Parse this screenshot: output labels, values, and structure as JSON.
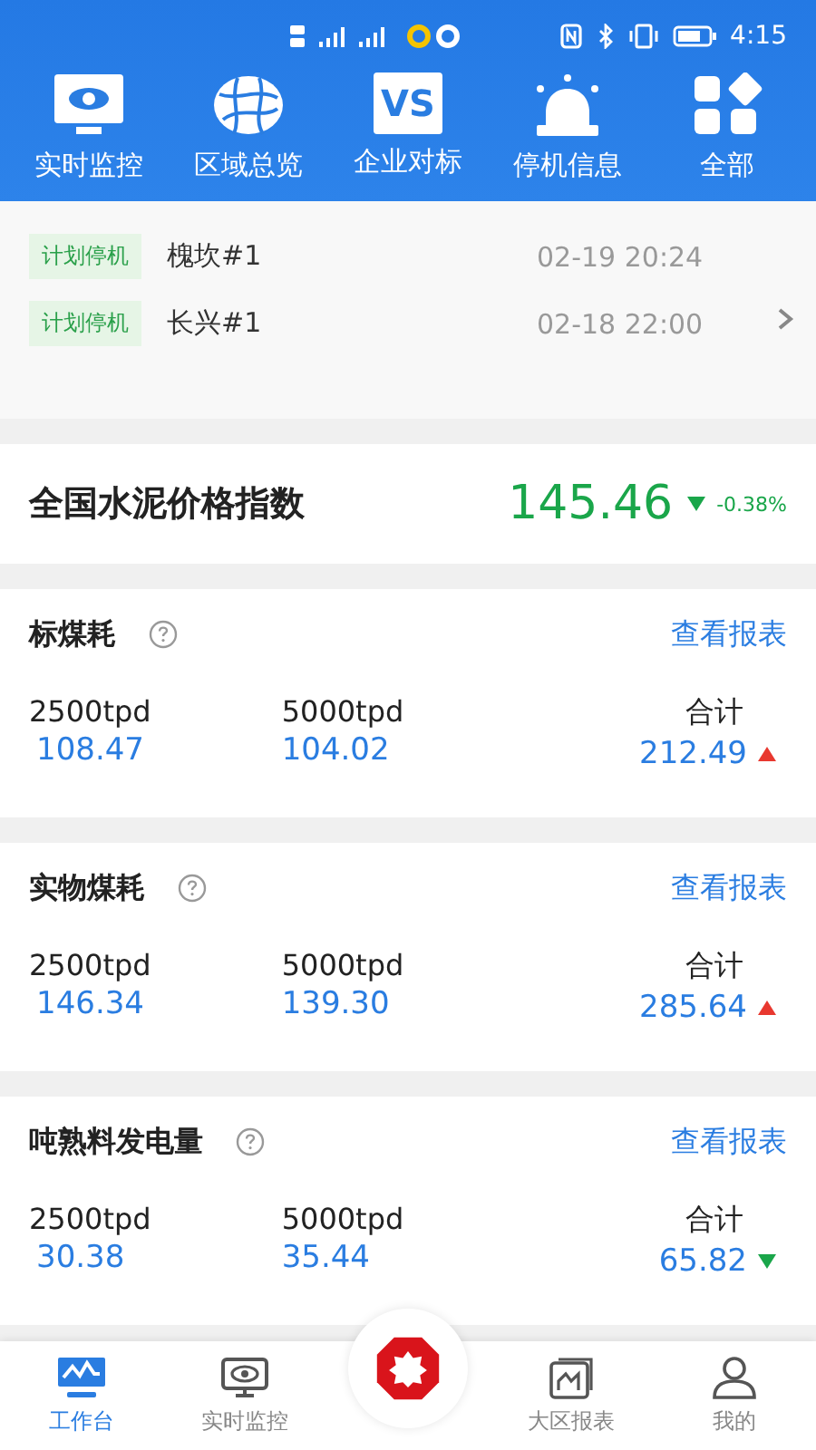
{
  "status_bar": {
    "time": "4:15"
  },
  "quick_nav": [
    {
      "label": "实时监控"
    },
    {
      "label": "区域总览"
    },
    {
      "label": "企业对标",
      "badge": "VS"
    },
    {
      "label": "停机信息"
    },
    {
      "label": "全部"
    }
  ],
  "stoppages": [
    {
      "tag": "计划停机",
      "plant": "槐坎#1",
      "time": "02-19 20:24"
    },
    {
      "tag": "计划停机",
      "plant": "长兴#1",
      "time": "02-18 22:00"
    }
  ],
  "price_index": {
    "title": "全国水泥价格指数",
    "value": "145.46",
    "change": "-0.38%",
    "kind": "down"
  },
  "cards": [
    {
      "title": "标煤耗",
      "link": "查看报表",
      "columns": [
        {
          "label": "2500tpd",
          "value": "108.47"
        },
        {
          "label": "5000tpd",
          "value": "104.02"
        },
        {
          "label": "合计",
          "value": "212.49",
          "kind": "up"
        }
      ]
    },
    {
      "title": "实物煤耗",
      "link": "查看报表",
      "columns": [
        {
          "label": "2500tpd",
          "value": "146.34"
        },
        {
          "label": "5000tpd",
          "value": "139.30"
        },
        {
          "label": "合计",
          "value": "285.64",
          "kind": "up"
        }
      ]
    },
    {
      "title": "吨熟料发电量",
      "link": "查看报表",
      "columns": [
        {
          "label": "2500tpd",
          "value": "30.38"
        },
        {
          "label": "5000tpd",
          "value": "35.44"
        },
        {
          "label": "合计",
          "value": "65.82",
          "kind": "down"
        }
      ]
    }
  ],
  "bottom_nav": [
    {
      "label": "工作台",
      "selected": true
    },
    {
      "label": "实时监控",
      "selected": false
    },
    {
      "kind": "center"
    },
    {
      "label": "大区报表",
      "selected": false
    },
    {
      "label": "我的",
      "selected": false
    }
  ]
}
